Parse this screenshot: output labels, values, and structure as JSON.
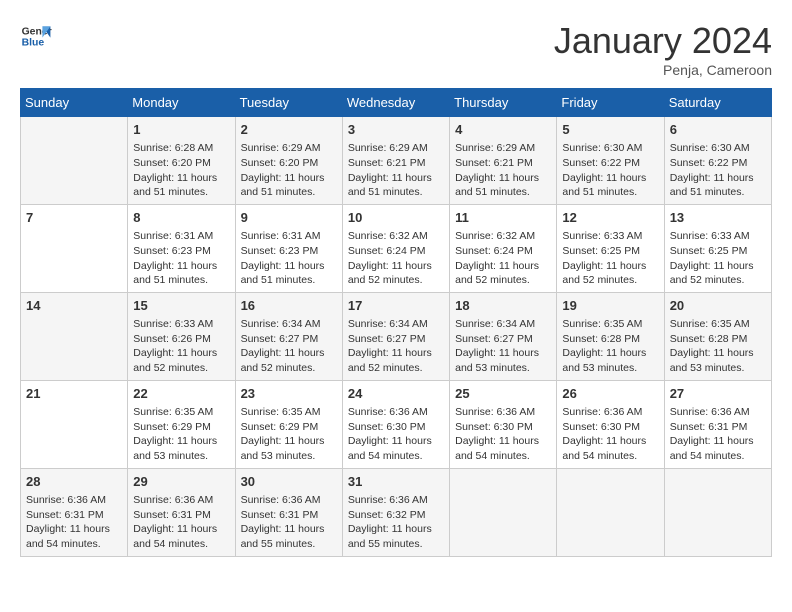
{
  "header": {
    "logo_line1": "General",
    "logo_line2": "Blue",
    "month_title": "January 2024",
    "location": "Penja, Cameroon"
  },
  "weekdays": [
    "Sunday",
    "Monday",
    "Tuesday",
    "Wednesday",
    "Thursday",
    "Friday",
    "Saturday"
  ],
  "weeks": [
    [
      {
        "day": "",
        "info": ""
      },
      {
        "day": "1",
        "info": "Sunrise: 6:28 AM\nSunset: 6:20 PM\nDaylight: 11 hours\nand 51 minutes."
      },
      {
        "day": "2",
        "info": "Sunrise: 6:29 AM\nSunset: 6:20 PM\nDaylight: 11 hours\nand 51 minutes."
      },
      {
        "day": "3",
        "info": "Sunrise: 6:29 AM\nSunset: 6:21 PM\nDaylight: 11 hours\nand 51 minutes."
      },
      {
        "day": "4",
        "info": "Sunrise: 6:29 AM\nSunset: 6:21 PM\nDaylight: 11 hours\nand 51 minutes."
      },
      {
        "day": "5",
        "info": "Sunrise: 6:30 AM\nSunset: 6:22 PM\nDaylight: 11 hours\nand 51 minutes."
      },
      {
        "day": "6",
        "info": "Sunrise: 6:30 AM\nSunset: 6:22 PM\nDaylight: 11 hours\nand 51 minutes."
      }
    ],
    [
      {
        "day": "7",
        "info": ""
      },
      {
        "day": "8",
        "info": "Sunrise: 6:31 AM\nSunset: 6:23 PM\nDaylight: 11 hours\nand 51 minutes."
      },
      {
        "day": "9",
        "info": "Sunrise: 6:31 AM\nSunset: 6:23 PM\nDaylight: 11 hours\nand 51 minutes."
      },
      {
        "day": "10",
        "info": "Sunrise: 6:32 AM\nSunset: 6:24 PM\nDaylight: 11 hours\nand 52 minutes."
      },
      {
        "day": "11",
        "info": "Sunrise: 6:32 AM\nSunset: 6:24 PM\nDaylight: 11 hours\nand 52 minutes."
      },
      {
        "day": "12",
        "info": "Sunrise: 6:33 AM\nSunset: 6:25 PM\nDaylight: 11 hours\nand 52 minutes."
      },
      {
        "day": "13",
        "info": "Sunrise: 6:33 AM\nSunset: 6:25 PM\nDaylight: 11 hours\nand 52 minutes."
      }
    ],
    [
      {
        "day": "14",
        "info": ""
      },
      {
        "day": "15",
        "info": "Sunrise: 6:33 AM\nSunset: 6:26 PM\nDaylight: 11 hours\nand 52 minutes."
      },
      {
        "day": "16",
        "info": "Sunrise: 6:34 AM\nSunset: 6:27 PM\nDaylight: 11 hours\nand 52 minutes."
      },
      {
        "day": "17",
        "info": "Sunrise: 6:34 AM\nSunset: 6:27 PM\nDaylight: 11 hours\nand 52 minutes."
      },
      {
        "day": "18",
        "info": "Sunrise: 6:34 AM\nSunset: 6:27 PM\nDaylight: 11 hours\nand 53 minutes."
      },
      {
        "day": "19",
        "info": "Sunrise: 6:35 AM\nSunset: 6:28 PM\nDaylight: 11 hours\nand 53 minutes."
      },
      {
        "day": "20",
        "info": "Sunrise: 6:35 AM\nSunset: 6:28 PM\nDaylight: 11 hours\nand 53 minutes."
      }
    ],
    [
      {
        "day": "21",
        "info": ""
      },
      {
        "day": "22",
        "info": "Sunrise: 6:35 AM\nSunset: 6:29 PM\nDaylight: 11 hours\nand 53 minutes."
      },
      {
        "day": "23",
        "info": "Sunrise: 6:35 AM\nSunset: 6:29 PM\nDaylight: 11 hours\nand 53 minutes."
      },
      {
        "day": "24",
        "info": "Sunrise: 6:36 AM\nSunset: 6:30 PM\nDaylight: 11 hours\nand 54 minutes."
      },
      {
        "day": "25",
        "info": "Sunrise: 6:36 AM\nSunset: 6:30 PM\nDaylight: 11 hours\nand 54 minutes."
      },
      {
        "day": "26",
        "info": "Sunrise: 6:36 AM\nSunset: 6:30 PM\nDaylight: 11 hours\nand 54 minutes."
      },
      {
        "day": "27",
        "info": "Sunrise: 6:36 AM\nSunset: 6:31 PM\nDaylight: 11 hours\nand 54 minutes."
      }
    ],
    [
      {
        "day": "28",
        "info": "Sunrise: 6:36 AM\nSunset: 6:31 PM\nDaylight: 11 hours\nand 54 minutes."
      },
      {
        "day": "29",
        "info": "Sunrise: 6:36 AM\nSunset: 6:31 PM\nDaylight: 11 hours\nand 54 minutes."
      },
      {
        "day": "30",
        "info": "Sunrise: 6:36 AM\nSunset: 6:31 PM\nDaylight: 11 hours\nand 55 minutes."
      },
      {
        "day": "31",
        "info": "Sunrise: 6:36 AM\nSunset: 6:32 PM\nDaylight: 11 hours\nand 55 minutes."
      },
      {
        "day": "",
        "info": ""
      },
      {
        "day": "",
        "info": ""
      },
      {
        "day": "",
        "info": ""
      }
    ]
  ]
}
